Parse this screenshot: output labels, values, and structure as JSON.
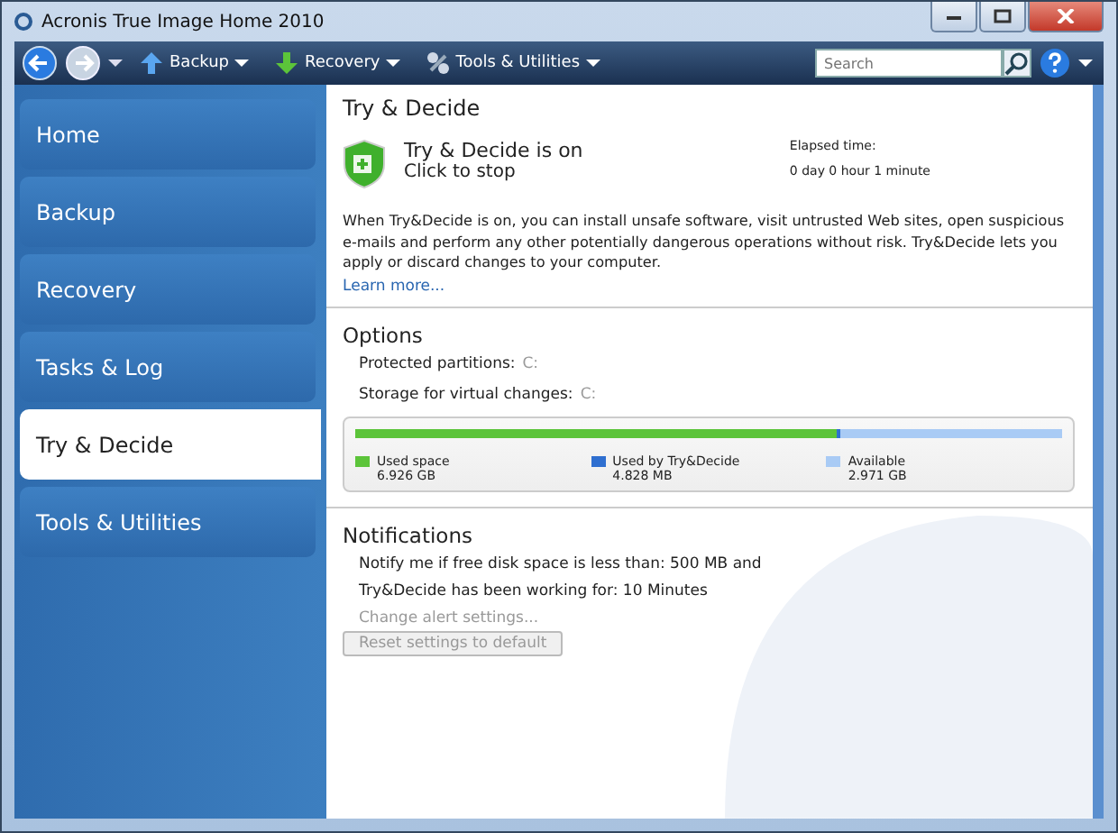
{
  "window": {
    "title": "Acronis True Image Home 2010"
  },
  "toolbar": {
    "menus": [
      {
        "label": "Backup",
        "kind": "backup"
      },
      {
        "label": "Recovery",
        "kind": "recovery"
      },
      {
        "label": "Tools & Utilities",
        "kind": "tools"
      }
    ],
    "search": {
      "placeholder": "Search"
    }
  },
  "sidebar": {
    "items": [
      {
        "label": "Home",
        "selected": false
      },
      {
        "label": "Backup",
        "selected": false
      },
      {
        "label": "Recovery",
        "selected": false
      },
      {
        "label": "Tasks & Log",
        "selected": false
      },
      {
        "label": "Try & Decide",
        "selected": true
      },
      {
        "label": "Tools & Utilities",
        "selected": false
      }
    ]
  },
  "page": {
    "title": "Try & Decide",
    "status": {
      "on": true,
      "title": "Try & Decide is on",
      "action": "Click to stop"
    },
    "elapsed": {
      "label": "Elapsed time:",
      "value": "0 day 0 hour 1 minute"
    },
    "description": "When Try&Decide is on, you can install unsafe software, visit untrusted Web sites, open suspicious e-mails and perform any other potentially dangerous operations without risk. Try&Decide lets you apply or discard changes to your computer.",
    "learn_more": "Learn more...",
    "options": {
      "title": "Options",
      "protected_label": "Protected partitions:",
      "protected_value": "C:",
      "storage_label": "Storage for virtual changes:",
      "storage_value": "C:",
      "segments": [
        {
          "label": "Used space",
          "value": "6.926 GB",
          "color": "#5cc43a",
          "level": 0.68
        },
        {
          "label": "Used by Try&Decide",
          "value": "4.828 MB",
          "color": "#2f6fd0",
          "level": 0.005
        },
        {
          "label": "Available",
          "value": "2.971 GB",
          "color": "#a9cbf5",
          "level": 0.315
        }
      ]
    },
    "notifications": {
      "title": "Notifications",
      "lines": [
        "Notify me if free disk space is less than: 500 MB and",
        "Try&Decide has been working for: 10 Minutes"
      ],
      "change_link": {
        "label": "Change alert settings...",
        "disabled": true
      },
      "reset_button": {
        "label": "Reset settings to default",
        "disabled": true
      }
    }
  }
}
